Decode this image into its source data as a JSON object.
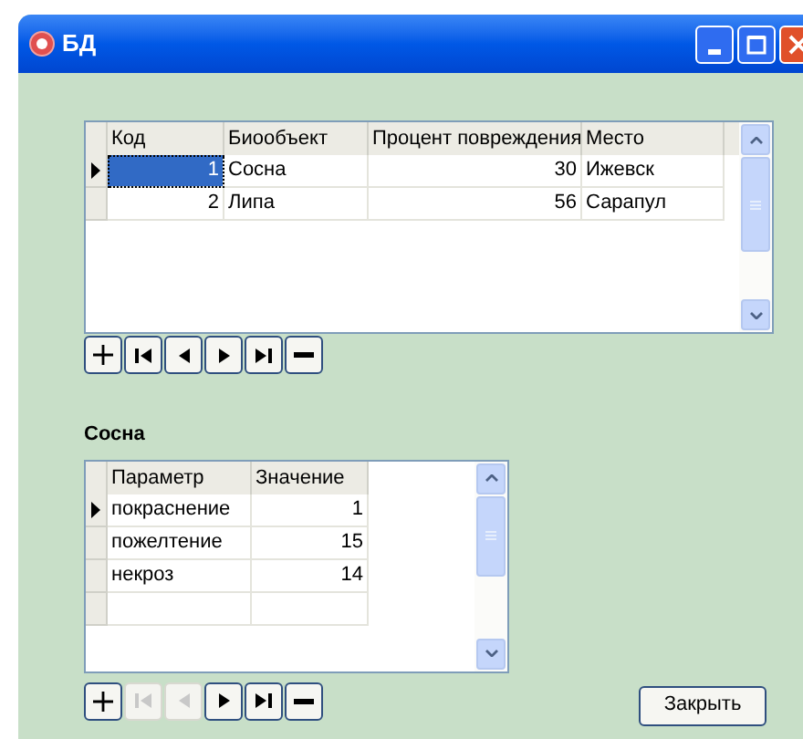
{
  "window": {
    "title": "БД"
  },
  "main_table": {
    "columns": [
      "Код",
      "Биообъект",
      "Процент повреждения",
      "Место"
    ],
    "rows": [
      {
        "cells": [
          "1",
          "Сосна",
          "30",
          "Ижевск"
        ],
        "selected": true
      },
      {
        "cells": [
          "2",
          "Липа",
          "56",
          "Сарапул"
        ],
        "selected": false
      }
    ]
  },
  "main_navigator": [
    {
      "kind": "add",
      "disabled": false
    },
    {
      "kind": "first",
      "disabled": false
    },
    {
      "kind": "prior",
      "disabled": false
    },
    {
      "kind": "next",
      "disabled": false
    },
    {
      "kind": "last",
      "disabled": false
    },
    {
      "kind": "delete",
      "disabled": false
    }
  ],
  "detail_title": "Сосна",
  "detail_table": {
    "columns": [
      "Параметр",
      "Значение"
    ],
    "rows": [
      {
        "cells": [
          "покраснение",
          "1"
        ],
        "selected": true
      },
      {
        "cells": [
          "пожелтение",
          "15"
        ],
        "selected": false
      },
      {
        "cells": [
          "некроз",
          "14"
        ],
        "selected": false
      }
    ]
  },
  "detail_navigator": [
    {
      "kind": "add",
      "disabled": false
    },
    {
      "kind": "first",
      "disabled": true
    },
    {
      "kind": "prior",
      "disabled": true
    },
    {
      "kind": "next",
      "disabled": false
    },
    {
      "kind": "last",
      "disabled": false
    },
    {
      "kind": "delete",
      "disabled": false
    }
  ],
  "close_button": "Закрыть"
}
